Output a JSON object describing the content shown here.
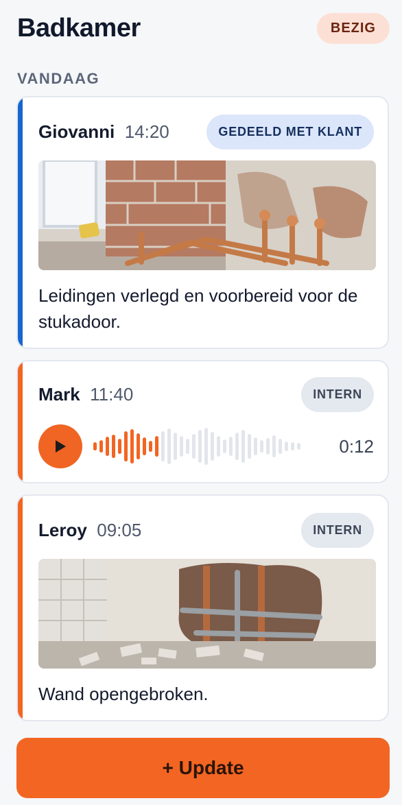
{
  "header": {
    "title": "Badkamer",
    "status": "BEZIG"
  },
  "section": {
    "label": "VANDAAG"
  },
  "updates": [
    {
      "author": "Giovanni",
      "time": "14:20",
      "badge": "GEDEELD MET KLANT",
      "type": "photo",
      "photo": "copper-pipes-photo",
      "text": "Leidingen verlegd en voorbereid voor de stukadoor.",
      "accent": "#1766d0"
    },
    {
      "author": "Mark",
      "time": "11:40",
      "badge": "INTERN",
      "type": "audio",
      "duration": "0:12",
      "accent": "#f26522"
    },
    {
      "author": "Leroy",
      "time": "09:05",
      "badge": "INTERN",
      "type": "photo",
      "photo": "broken-wall-photo",
      "text": "Wand opengebroken.",
      "accent": "#f26522"
    }
  ],
  "actions": {
    "update_label": "+ Update"
  },
  "colors": {
    "brand_orange": "#f26522",
    "shared_blue": "#1766d0",
    "status_bg": "#fde0d5"
  }
}
